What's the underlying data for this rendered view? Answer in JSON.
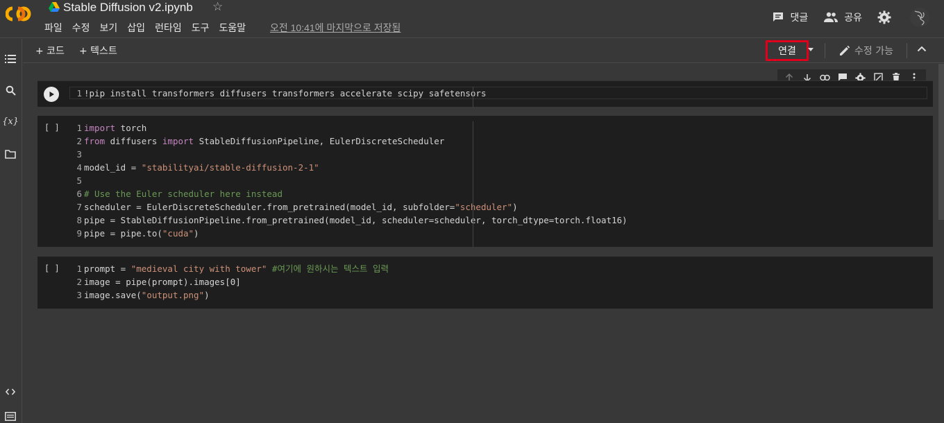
{
  "header": {
    "title": "Stable Diffusion v2.ipynb",
    "menu": [
      "파일",
      "수정",
      "보기",
      "삽입",
      "런타임",
      "도구",
      "도움말"
    ],
    "saved_status": "오전 10:41에 마지막으로 저장됨",
    "comment_label": "댓글",
    "share_label": "공유"
  },
  "toolbar": {
    "add_code": "+ 코드",
    "add_text": "+ 텍스트",
    "connect_label": "연결",
    "edit_mode": "수정 가능"
  },
  "colors": {
    "connect_highlight": "#e1001b",
    "keyword": "#c586c0",
    "string": "#ce9178",
    "comment": "#6a9955"
  },
  "cells": [
    {
      "bracket": "",
      "lines": [
        [
          {
            "t": "!pip install transformers diffusers transformers accelerate scipy safetensors",
            "c": ""
          }
        ]
      ]
    },
    {
      "bracket": "[ ]",
      "lines": [
        [
          {
            "t": "import",
            "c": "kw"
          },
          {
            "t": " torch",
            "c": ""
          }
        ],
        [
          {
            "t": "from",
            "c": "kw"
          },
          {
            "t": " diffusers ",
            "c": ""
          },
          {
            "t": "import",
            "c": "kw"
          },
          {
            "t": " StableDiffusionPipeline, EulerDiscreteScheduler",
            "c": ""
          }
        ],
        [],
        [
          {
            "t": "model_id = ",
            "c": ""
          },
          {
            "t": "\"stabilityai/stable-diffusion-2-1\"",
            "c": "str"
          }
        ],
        [],
        [
          {
            "t": "# Use the Euler scheduler here instead",
            "c": "cm"
          }
        ],
        [
          {
            "t": "scheduler = EulerDiscreteScheduler.from_pretrained(model_id, subfolder=",
            "c": ""
          },
          {
            "t": "\"scheduler\"",
            "c": "str"
          },
          {
            "t": ")",
            "c": ""
          }
        ],
        [
          {
            "t": "pipe = StableDiffusionPipeline.from_pretrained(model_id, scheduler=scheduler, torch_dtype=torch.float16)",
            "c": ""
          }
        ],
        [
          {
            "t": "pipe = pipe.to(",
            "c": ""
          },
          {
            "t": "\"cuda\"",
            "c": "str"
          },
          {
            "t": ")",
            "c": ""
          }
        ]
      ]
    },
    {
      "bracket": "[ ]",
      "lines": [
        [
          {
            "t": "prompt = ",
            "c": ""
          },
          {
            "t": "\"medieval city with tower\"",
            "c": "str"
          },
          {
            "t": " #여기에 원하시는 텍스트 입력",
            "c": "cm"
          }
        ],
        [
          {
            "t": "image = pipe(prompt).images[0]",
            "c": ""
          }
        ],
        [
          {
            "t": "image.save(",
            "c": ""
          },
          {
            "t": "\"output.png\"",
            "c": "str"
          },
          {
            "t": ")",
            "c": ""
          }
        ]
      ]
    }
  ]
}
